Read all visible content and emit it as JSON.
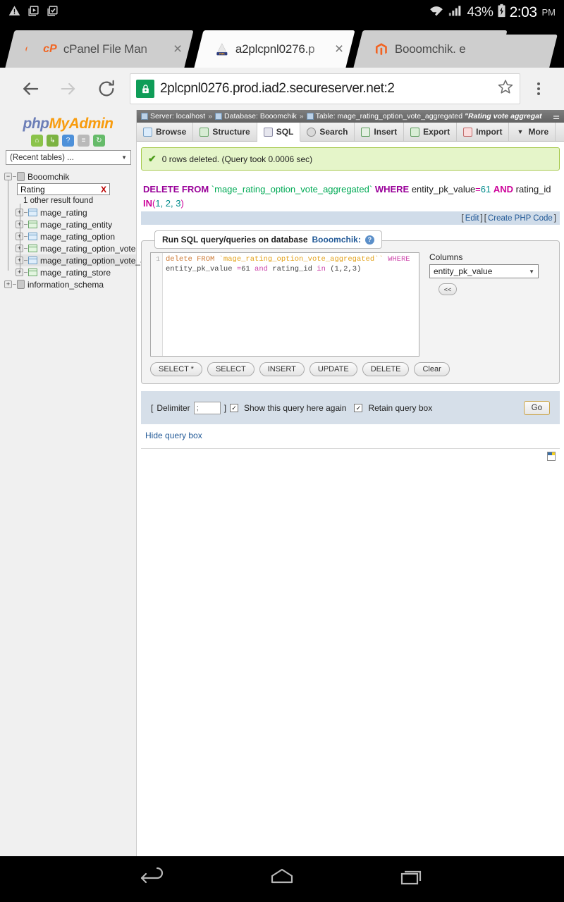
{
  "status_bar": {
    "icons": [
      "warning-triangle-icon",
      "app-install-icon",
      "app-installed-icon"
    ],
    "wifi_icon": "wifi-transfer-icon",
    "signal_icon": "cell-signal-icon",
    "battery_percent": "43%",
    "battery_icon": "battery-charging-icon",
    "time": "2:03",
    "ampm": "PM"
  },
  "browser": {
    "tabs": [
      {
        "favicon": "cpanel-icon",
        "title": "cPanel File Man",
        "close": "×",
        "active": false
      },
      {
        "favicon": "phpmyadmin-icon",
        "title": "a2plcpnl0276.p",
        "close": "×",
        "active": true
      },
      {
        "favicon": "magento-icon",
        "title": "Booomchik. е",
        "close": "",
        "active": false
      }
    ],
    "toolbar": {
      "back_icon": "back-arrow-icon",
      "forward_icon": "forward-arrow-icon",
      "reload_icon": "reload-icon",
      "lock_icon": "secure-lock-icon",
      "url": "2plcpnl0276.prod.iad2.secureserver.net:2",
      "bookmark_icon": "star-icon",
      "menu_icon": "overflow-menu-icon"
    }
  },
  "sidebar": {
    "logo_php": "php",
    "logo_myadmin": "MyAdmin",
    "nav_icons": [
      {
        "name": "home-icon",
        "glyph": "⌂"
      },
      {
        "name": "logout-icon",
        "glyph": "↪"
      },
      {
        "name": "help-icon",
        "glyph": "?"
      },
      {
        "name": "docs-icon",
        "glyph": "≡"
      },
      {
        "name": "reload-navigation-icon",
        "glyph": "↻"
      }
    ],
    "recent_tables_label": "(Recent tables) ...",
    "db_name": "Booomchik",
    "search_value": "Rating",
    "search_clear": "X",
    "other_result": "1 other result found",
    "tables": [
      "mage_rating",
      "mage_rating_entity",
      "mage_rating_option",
      "mage_rating_option_vote",
      "mage_rating_option_vote_ag",
      "mage_rating_store"
    ],
    "highlighted_table_index": 4,
    "information_schema": "information_schema"
  },
  "breadcrumb": {
    "server_label": "Server: localhost",
    "database_label": "Database: Booomchik",
    "table_label": "Table: mage_rating_option_vote_aggregated",
    "table_comment": "\"Rating vote aggregat",
    "separator": "»",
    "collapse_icon": "collapse-icon"
  },
  "tabs_nav": [
    {
      "label": "Browse",
      "icon": "browse-icon",
      "selected": false
    },
    {
      "label": "Structure",
      "icon": "structure-icon",
      "selected": false
    },
    {
      "label": "SQL",
      "icon": "sql-icon",
      "selected": true
    },
    {
      "label": "Search",
      "icon": "search-icon",
      "selected": false
    },
    {
      "label": "Insert",
      "icon": "insert-icon",
      "selected": false
    },
    {
      "label": "Export",
      "icon": "export-icon",
      "selected": false
    },
    {
      "label": "Import",
      "icon": "import-icon",
      "selected": false
    },
    {
      "label": "More",
      "icon": "chevron-down-icon",
      "selected": false
    }
  ],
  "notice": {
    "icon": "success-check-icon",
    "text": "0 rows deleted. (Query took 0.0006 sec)"
  },
  "executed_query": {
    "k_delete": "DELETE FROM",
    "table": "`mage_rating_option_vote_aggregated`",
    "k_where": "WHERE",
    "field1": "entity_pk_value",
    "eq": "=",
    "value1": "61",
    "k_and": "AND",
    "field2": "rating_id",
    "k_in": "IN",
    "paren_open": "(",
    "in_values": "1, 2, 3",
    "paren_close": ")",
    "edit_link": "Edit",
    "php_link": "Create PHP Code",
    "bracket_open": "[",
    "bracket_close": "]"
  },
  "query_form": {
    "legend_text": "Run SQL query/queries on database",
    "legend_db": "Booomchik:",
    "help_icon": "help-icon",
    "line_number": "1",
    "sql_text": "delete FROM `mage_rating_option_vote_aggregated`` WHERE entity_pk_value =61 and rating_id in (1,2,3)",
    "sql_tokens": [
      {
        "t": "delete",
        "c": "c-kw"
      },
      {
        "t": " FROM ",
        "c": "c-kw"
      },
      {
        "t": "`mage_rating_option_vote_aggregated``",
        "c": "c-str"
      },
      {
        "t": " WHERE",
        "c": "c-kw2"
      },
      {
        "t": "\nentity_pk_value ",
        "c": "c-num"
      },
      {
        "t": "=",
        "c": "c-kw2"
      },
      {
        "t": "61 ",
        "c": "c-num"
      },
      {
        "t": "and ",
        "c": "c-kw2"
      },
      {
        "t": "rating_id ",
        "c": "c-num"
      },
      {
        "t": "in ",
        "c": "c-kw2"
      },
      {
        "t": "(1,2,3)",
        "c": "c-num"
      }
    ],
    "columns_label": "Columns",
    "columns_selected": "entity_pk_value",
    "insert_back_button": "<<",
    "buttons": [
      "SELECT *",
      "SELECT",
      "INSERT",
      "UPDATE",
      "DELETE",
      "Clear"
    ]
  },
  "delimiter_bar": {
    "bracket_open": "[",
    "label": "Delimiter",
    "value": ";",
    "bracket_close": "]",
    "show_query_label": "Show this query here again",
    "show_query_checked": true,
    "retain_label": "Retain query box",
    "retain_checked": true,
    "go_button": "Go"
  },
  "hide_query_link": "Hide query box",
  "notes_icon": "notes-icon",
  "android_nav": {
    "back": "back-nav-icon",
    "home": "home-nav-icon",
    "recents": "recents-nav-icon"
  }
}
